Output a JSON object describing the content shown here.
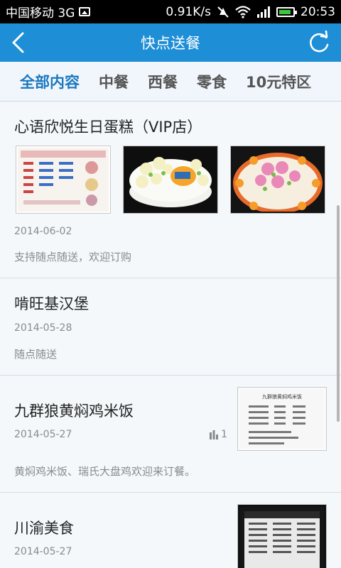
{
  "status_bar": {
    "carrier": "中国移动 3G",
    "speed": "0.91K/s",
    "time": "20:53"
  },
  "header": {
    "title": "快点送餐"
  },
  "tabs": [
    {
      "label": "全部内容",
      "active": true
    },
    {
      "label": "中餐",
      "active": false
    },
    {
      "label": "西餐",
      "active": false
    },
    {
      "label": "零食",
      "active": false
    },
    {
      "label": "10元特区",
      "active": false
    }
  ],
  "items": [
    {
      "title": "心语欣悦生日蛋糕（VIP店）",
      "date": "2014-06-02",
      "desc": "支持随点随送，欢迎订购"
    },
    {
      "title": "啃旺基汉堡",
      "date": "2014-05-28",
      "desc": "随点随送"
    },
    {
      "title": "九群狼黄焖鸡米饭",
      "date": "2014-05-27",
      "stat_count": "1",
      "desc": "黄焖鸡米饭、瑞氏大盘鸡欢迎来订餐。",
      "thumb_heading": "九群狼黄焖鸡米饭"
    },
    {
      "title": "川渝美食",
      "date": "2014-05-27"
    }
  ],
  "colors": {
    "header_bg": "#1e8ed6",
    "tab_active": "#1b78bf",
    "list_bg": "#f4f8fb"
  },
  "icons": [
    "back-arrow-icon",
    "refresh-icon",
    "bar-chart-icon",
    "wifi-icon",
    "signal-icon",
    "battery-icon",
    "mute-icon",
    "image-icon"
  ]
}
